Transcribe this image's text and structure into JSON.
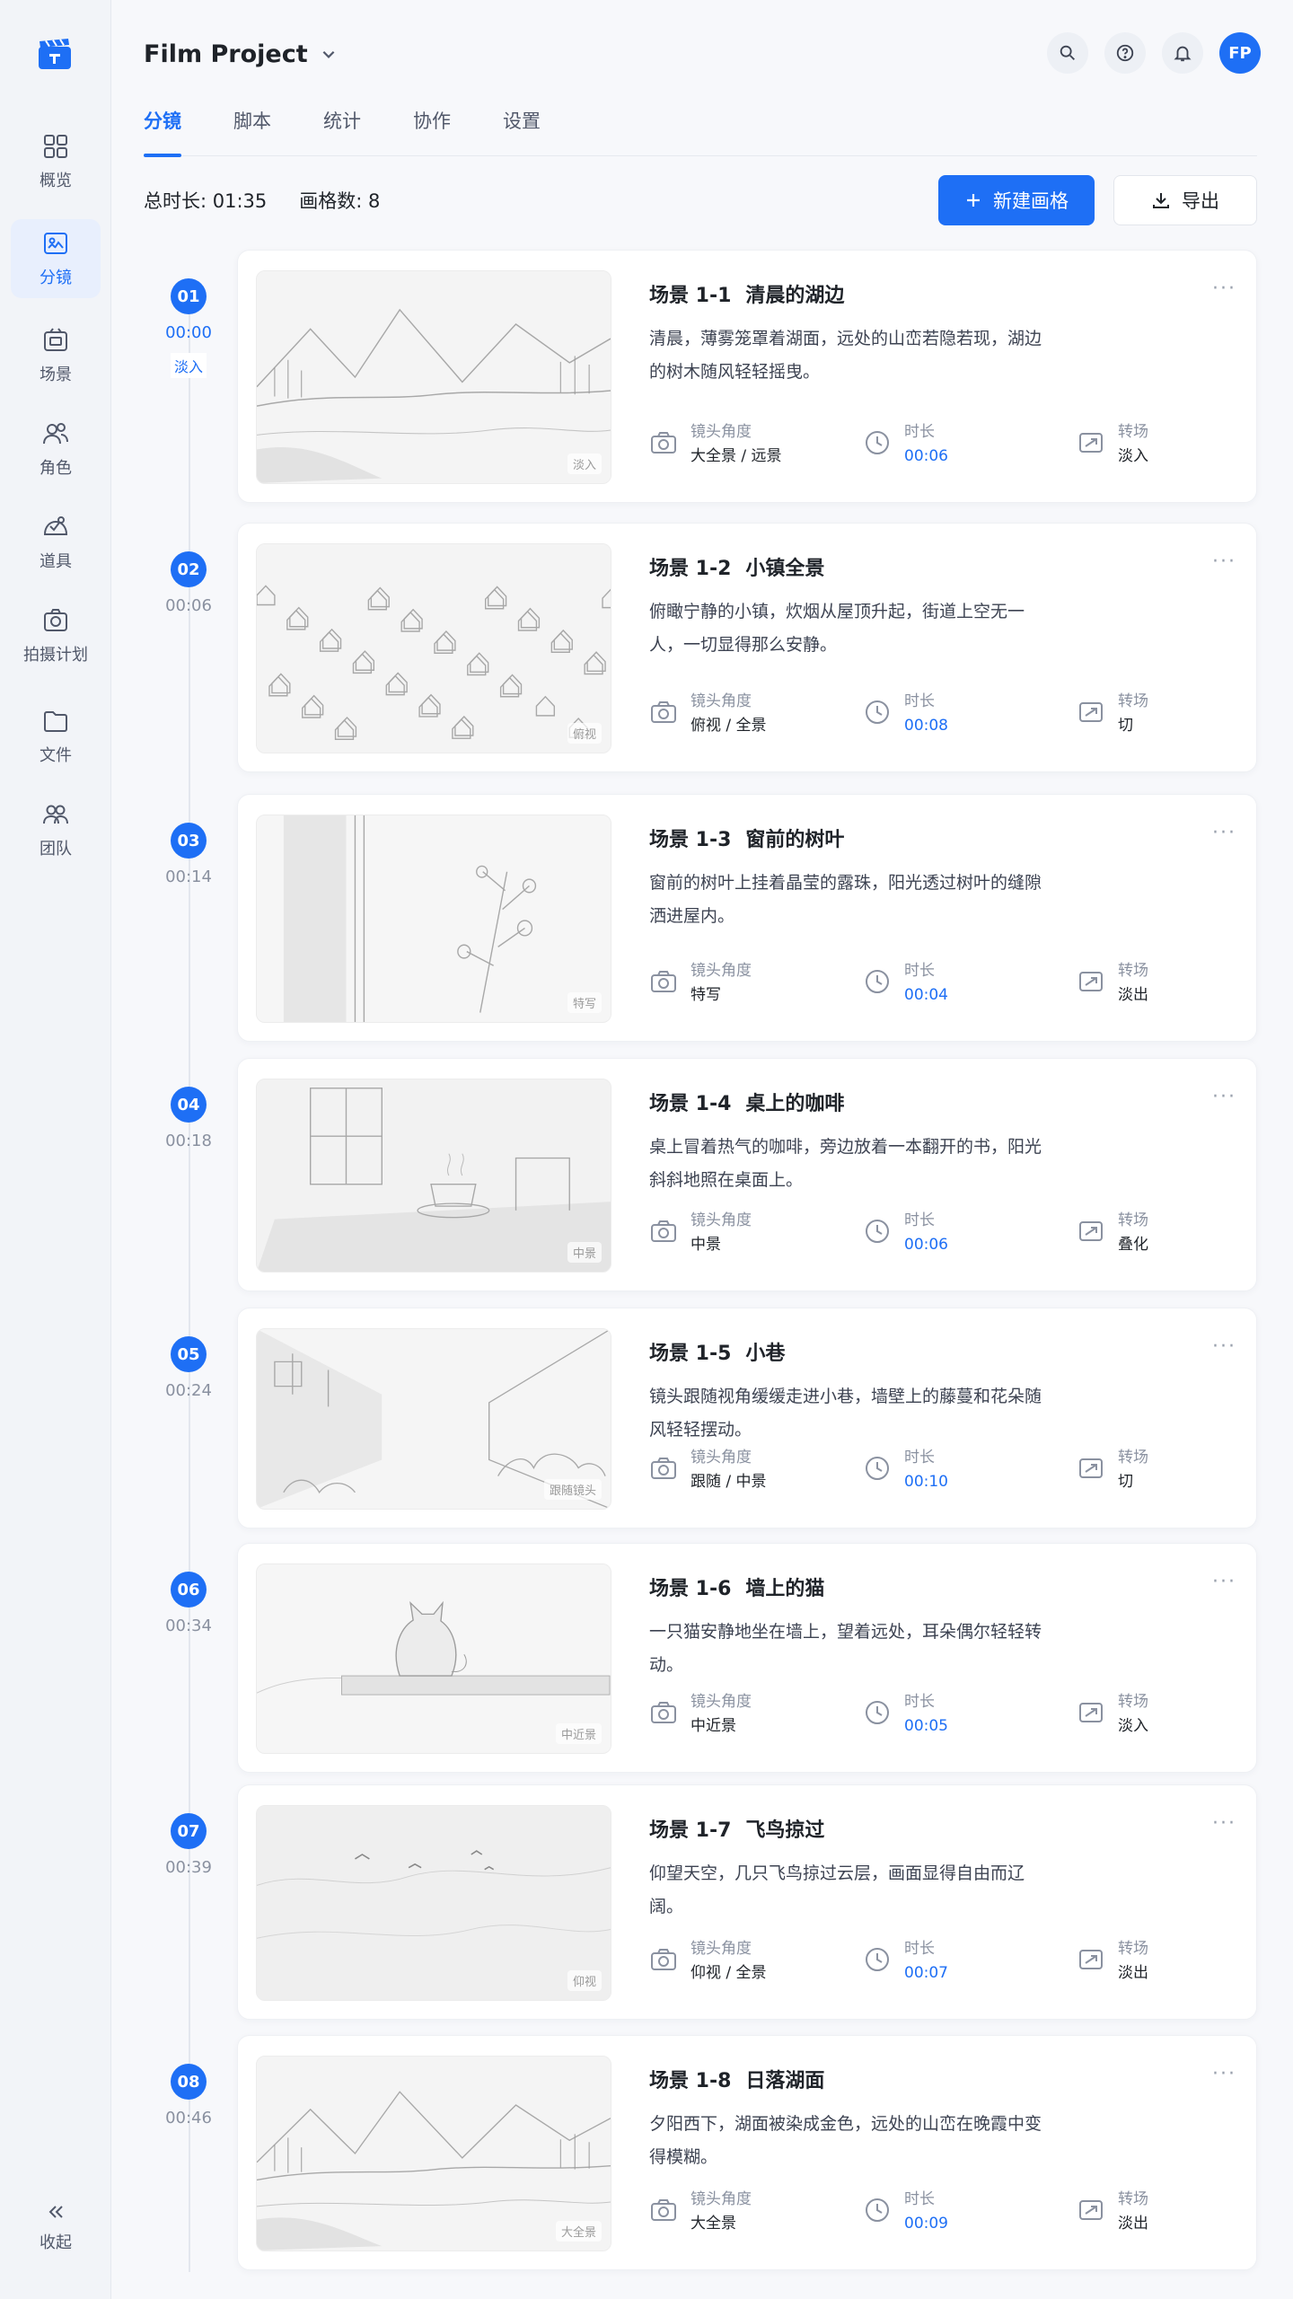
{
  "sidebar": {
    "items": [
      {
        "label": "概览",
        "icon": "grid-icon"
      },
      {
        "label": "分镜",
        "icon": "storyboard-icon",
        "active": true
      },
      {
        "label": "场景",
        "icon": "scene-icon"
      },
      {
        "label": "角色",
        "icon": "characters-icon"
      },
      {
        "label": "道具",
        "icon": "props-icon"
      },
      {
        "label": "拍摄计划",
        "icon": "camera-plan-icon"
      },
      {
        "label": "文件",
        "icon": "folder-icon"
      },
      {
        "label": "团队",
        "icon": "team-icon"
      }
    ],
    "collapse_label": "收起"
  },
  "header": {
    "project_name": "Film Project",
    "avatar_initials": "FP"
  },
  "tabs": [
    "分镜",
    "脚本",
    "统计",
    "协作",
    "设置"
  ],
  "stats": {
    "total_duration": "总时长: 01:35",
    "frame_count": "画格数: 8"
  },
  "actions": {
    "new_frame": "新建画格",
    "export": "导出"
  },
  "meta_labels": {
    "angle": "镜头角度",
    "duration": "时长",
    "transition": "转场"
  },
  "timeline_first_tag": "淡入",
  "frames": [
    {
      "num": "01",
      "time": "00:00",
      "title_id": "场景 1-1",
      "title": "清晨的湖边",
      "desc": "清晨，薄雾笼罩着湖面，远处的山峦若隐若现，湖边的树木随风轻轻摇曳。",
      "angle": "大全景 / 远景",
      "duration": "00:06",
      "transition": "淡入",
      "stamp": "淡入"
    },
    {
      "num": "02",
      "time": "00:06",
      "title_id": "场景 1-2",
      "title": "小镇全景",
      "desc": "俯瞰宁静的小镇，炊烟从屋顶升起，街道上空无一人，一切显得那么安静。",
      "angle": "俯视 / 全景",
      "duration": "00:08",
      "transition": "切",
      "stamp": "俯视"
    },
    {
      "num": "03",
      "time": "00:14",
      "title_id": "场景 1-3",
      "title": "窗前的树叶",
      "desc": "窗前的树叶上挂着晶莹的露珠，阳光透过树叶的缝隙洒进屋内。",
      "angle": "特写",
      "duration": "00:04",
      "transition": "淡出",
      "stamp": "特写"
    },
    {
      "num": "04",
      "time": "00:18",
      "title_id": "场景 1-4",
      "title": "桌上的咖啡",
      "desc": "桌上冒着热气的咖啡，旁边放着一本翻开的书，阳光斜斜地照在桌面上。",
      "angle": "中景",
      "duration": "00:06",
      "transition": "叠化",
      "stamp": "中景"
    },
    {
      "num": "05",
      "time": "00:24",
      "title_id": "场景 1-5",
      "title": "小巷",
      "desc": "镜头跟随视角缓缓走进小巷，墙壁上的藤蔓和花朵随风轻轻摆动。",
      "angle": "跟随 / 中景",
      "duration": "00:10",
      "transition": "切",
      "stamp": "跟随镜头"
    },
    {
      "num": "06",
      "time": "00:34",
      "title_id": "场景 1-6",
      "title": "墙上的猫",
      "desc": "一只猫安静地坐在墙上，望着远处，耳朵偶尔轻轻转动。",
      "angle": "中近景",
      "duration": "00:05",
      "transition": "淡入",
      "stamp": "中近景"
    },
    {
      "num": "07",
      "time": "00:39",
      "title_id": "场景 1-7",
      "title": "飞鸟掠过",
      "desc": "仰望天空，几只飞鸟掠过云层，画面显得自由而辽阔。",
      "angle": "仰视 / 全景",
      "duration": "00:07",
      "transition": "淡出",
      "stamp": "仰视"
    },
    {
      "num": "08",
      "time": "00:46",
      "title_id": "场景 1-8",
      "title": "日落湖面",
      "desc": "夕阳西下，湖面被染成金色，远处的山峦在晚霞中变得模糊。",
      "angle": "大全景",
      "duration": "00:09",
      "transition": "淡出",
      "stamp": "大全景"
    }
  ],
  "colors": {
    "accent": "#1e6ff5",
    "muted": "#8a91a0"
  }
}
